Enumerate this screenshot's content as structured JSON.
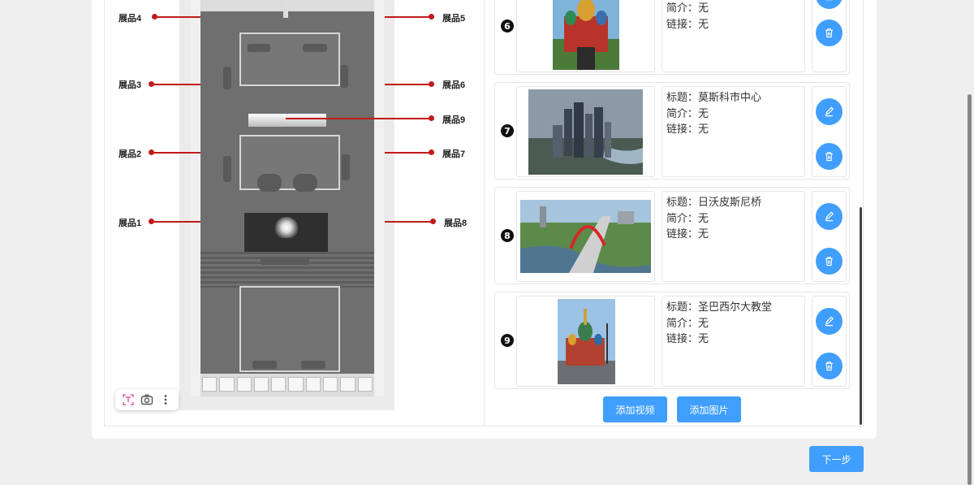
{
  "floor_plan": {
    "exhibits": [
      {
        "id": "4",
        "label": "展品4",
        "side": "left"
      },
      {
        "id": "3",
        "label": "展品3",
        "side": "left"
      },
      {
        "id": "2",
        "label": "展品2",
        "side": "left"
      },
      {
        "id": "1",
        "label": "展品1",
        "side": "left"
      },
      {
        "id": "5",
        "label": "展品5",
        "side": "right"
      },
      {
        "id": "6",
        "label": "展品6",
        "side": "right"
      },
      {
        "id": "9",
        "label": "展品9",
        "side": "right"
      },
      {
        "id": "7",
        "label": "展品7",
        "side": "right"
      },
      {
        "id": "8",
        "label": "展品8",
        "side": "right"
      }
    ],
    "toolbar": {
      "icons": [
        "text-recognition-icon",
        "camera-icon",
        "more-vertical-icon"
      ]
    }
  },
  "media_list": {
    "title_prefix": "标题：",
    "intro_prefix": "简介：",
    "link_prefix": "链接：",
    "items": [
      {
        "number": "6",
        "title": "",
        "intro": "无",
        "link": "无",
        "image": "saint-basil-cathedral-photo"
      },
      {
        "number": "7",
        "title": "莫斯科市中心",
        "intro": "无",
        "link": "无",
        "image": "moscow-city-skyline-photo"
      },
      {
        "number": "8",
        "title": "日沃皮斯尼桥",
        "intro": "无",
        "link": "无",
        "image": "zhivopisny-bridge-photo"
      },
      {
        "number": "9",
        "title": "圣巴西尔大教堂",
        "intro": "无",
        "link": "无",
        "image": "saint-basil-cathedral-photo"
      }
    ],
    "add_video_label": "添加视频",
    "add_image_label": "添加图片"
  },
  "footer": {
    "next_label": "下一步"
  },
  "colors": {
    "primary": "#409eff",
    "marker_red": "#c21a1a",
    "page_bg": "#efefef"
  }
}
